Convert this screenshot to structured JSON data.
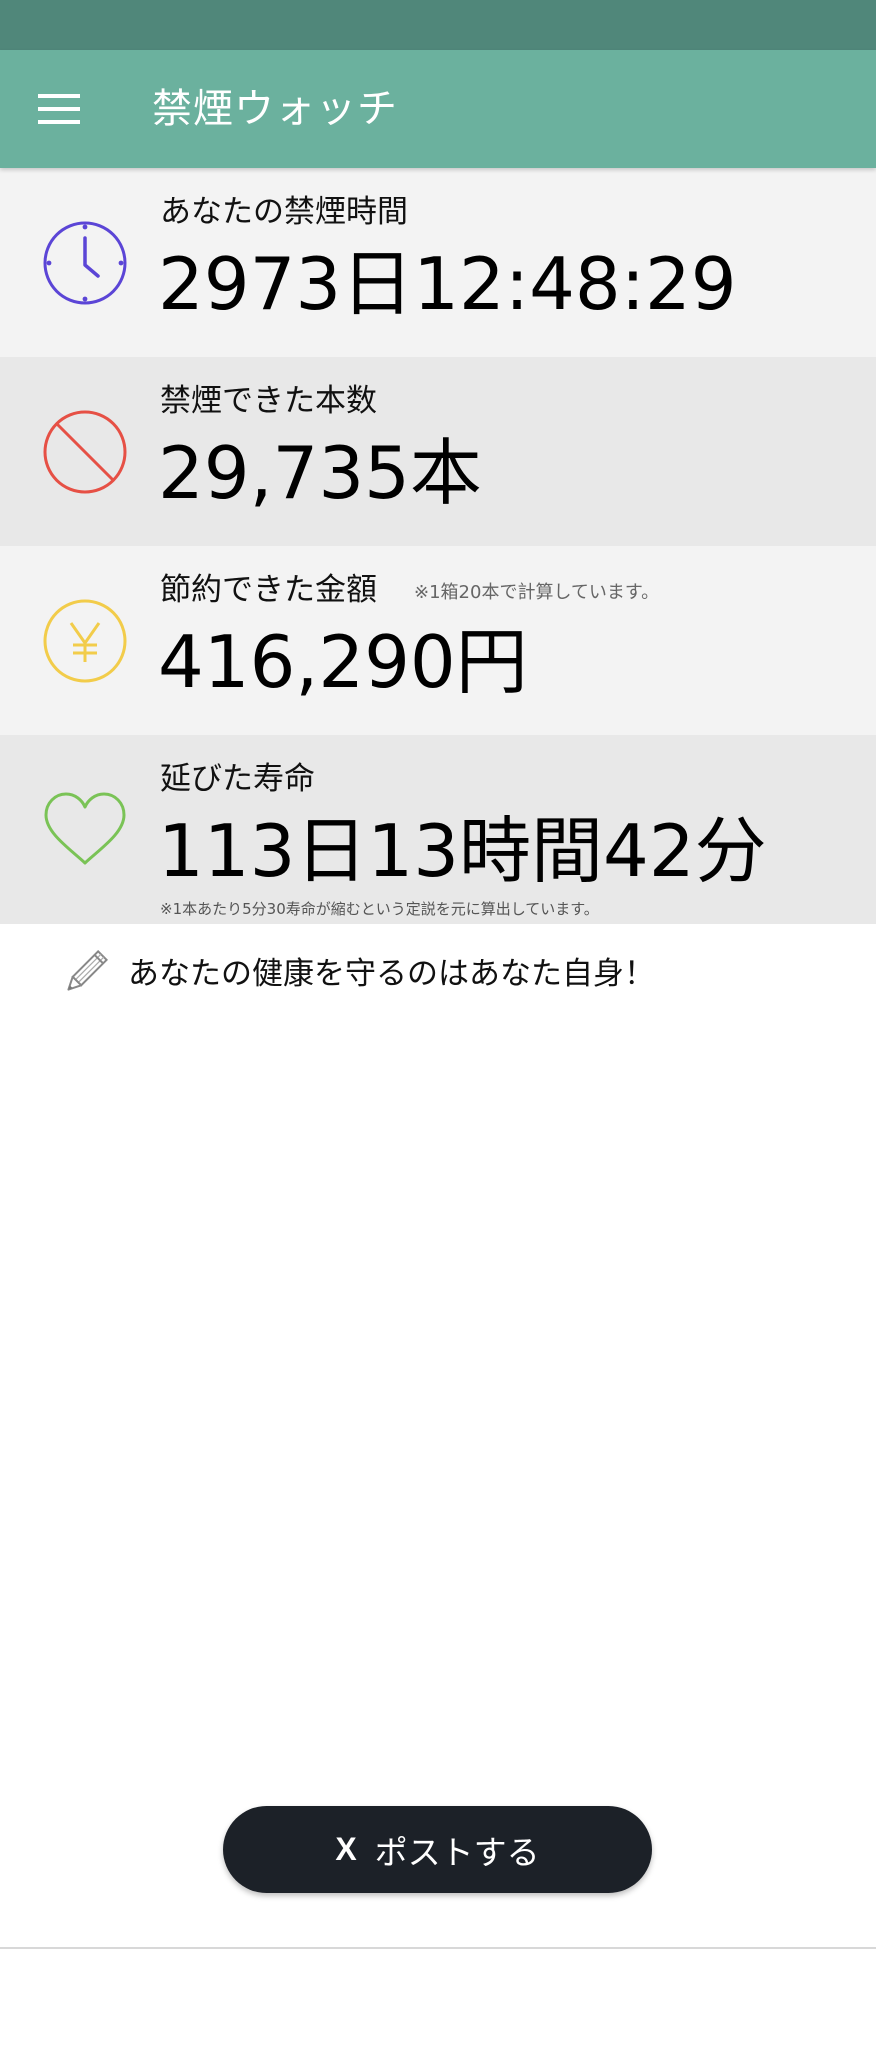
{
  "app_bar": {
    "title": "禁煙ウォッチ",
    "menu_icon": "hamburger-menu-icon",
    "background_color": "#6bb19e",
    "status_bar_color": "#50877a"
  },
  "stats": {
    "quit_time": {
      "label": "あなたの禁煙時間",
      "value": "2973日12:48:29",
      "icon": "clock-icon",
      "icon_color": "#5b45d6"
    },
    "cigarettes_avoided": {
      "label": "禁煙できた本数",
      "value": "29,735本",
      "icon": "prohibited-icon",
      "icon_color": "#e65045"
    },
    "money_saved": {
      "label": "節約できた金額",
      "note": "※1箱20本で計算しています。",
      "value": "416,290円",
      "icon": "yen-coin-icon",
      "icon_color": "#f2cc4a"
    },
    "life_extended": {
      "label": "延びた寿命",
      "value": "113日13時間42分",
      "note": "※1本あたり5分30寿命が縮むという定説を元に算出しています。",
      "icon": "heart-icon",
      "icon_color": "#7ac356"
    }
  },
  "message": {
    "icon": "pencil-icon",
    "text": "あなたの健康を守るのはあなた自身！"
  },
  "post_button": {
    "logo": "X",
    "label": "ポストする"
  }
}
